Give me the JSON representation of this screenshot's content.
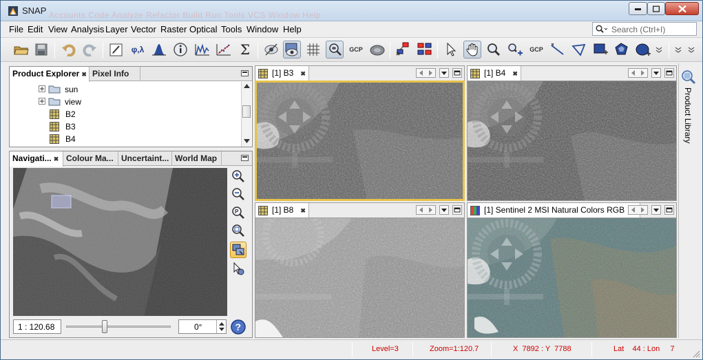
{
  "window": {
    "title": "SNAP",
    "ghost_menu": "Accounts  Code  Analyze  Refactor  Build  Run  Tools  VCS  Window  Help"
  },
  "menu": {
    "items": [
      "File",
      "Edit",
      "View",
      "Analysis",
      "Layer",
      "Vector",
      "Raster",
      "Optical",
      "Tools",
      "Window",
      "Help"
    ],
    "search_placeholder": "Search (Ctrl+I)"
  },
  "toolbar": {
    "gcp_label": "GCP",
    "spectrum_label": "φ,λ",
    "sigma_label": "Σ",
    "overflow_label": "»"
  },
  "product_explorer": {
    "tabs": [
      "Product Explorer",
      "Pixel Info"
    ],
    "tree": [
      {
        "label": "sun",
        "type": "folder"
      },
      {
        "label": "view",
        "type": "folder"
      },
      {
        "label": "B2",
        "type": "band"
      },
      {
        "label": "B3",
        "type": "band"
      },
      {
        "label": "B4",
        "type": "band"
      }
    ]
  },
  "lower_panel": {
    "tabs": [
      "Navigati...",
      "Colour Ma...",
      "Uncertaint...",
      "World Map"
    ],
    "zoom_value": "1 : 120.68",
    "rotation_value": "0°",
    "slider_fraction": 0.37
  },
  "views": [
    {
      "id": "b3",
      "title": "[1] B3"
    },
    {
      "id": "b4",
      "title": "[1] B4"
    },
    {
      "id": "b8",
      "title": "[1] B8"
    },
    {
      "id": "rgb",
      "title": "[1] Sentinel 2 MSI Natural Colors RGB"
    }
  ],
  "side": {
    "product_library": "Product Library"
  },
  "status": {
    "level": "Level=3",
    "zoom": "Zoom=1:120.7",
    "xy": "X  7892 : Y  7788",
    "lat": "Lat    44 : Lon     7"
  },
  "colors": {
    "selected_view_border": "#e6c24a",
    "status_text": "#cc0000"
  }
}
